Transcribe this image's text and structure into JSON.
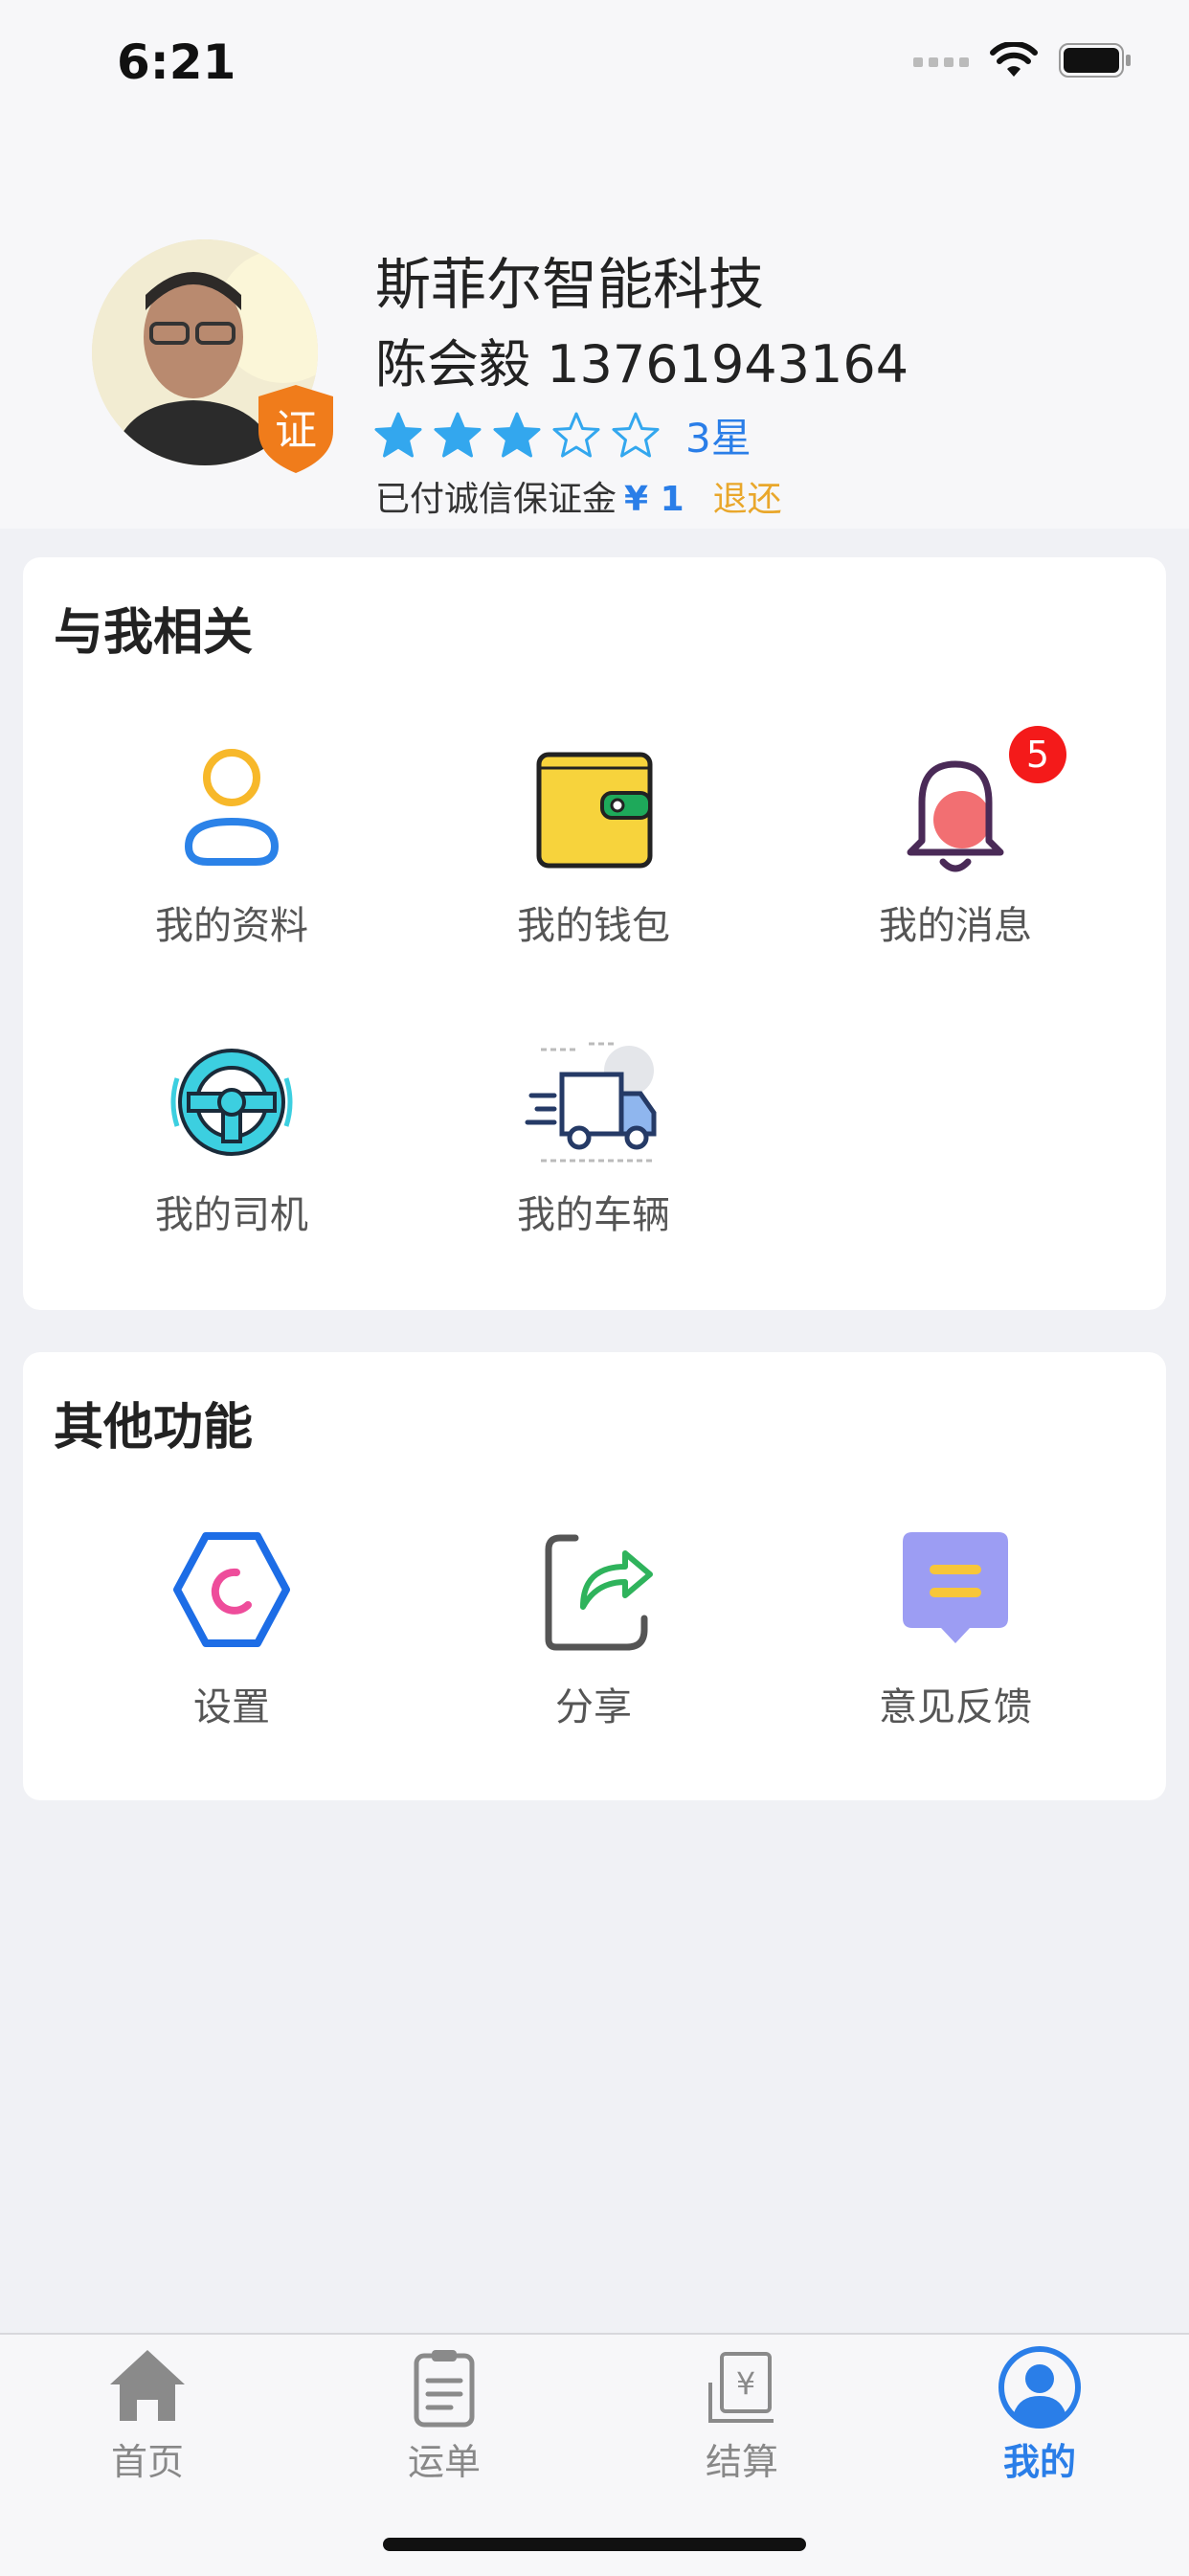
{
  "status_bar": {
    "time": "6:21"
  },
  "profile": {
    "company": "斯菲尔智能科技",
    "person": "陈会毅 13761943164",
    "rating_value": 3,
    "rating_max": 5,
    "rating_label": "3星",
    "deposit_label": "已付诚信保证金",
    "deposit_amount": "¥ 1",
    "refund_label": "退还",
    "cert_badge_text": "证"
  },
  "section_related": {
    "title": "与我相关",
    "items": [
      {
        "label": "我的资料",
        "icon": "profile-icon"
      },
      {
        "label": "我的钱包",
        "icon": "wallet-icon"
      },
      {
        "label": "我的消息",
        "icon": "bell-icon",
        "badge": "5"
      },
      {
        "label": "我的司机",
        "icon": "steering-wheel-icon"
      },
      {
        "label": "我的车辆",
        "icon": "truck-icon"
      }
    ]
  },
  "section_other": {
    "title": "其他功能",
    "items": [
      {
        "label": "设置",
        "icon": "settings-icon"
      },
      {
        "label": "分享",
        "icon": "share-icon"
      },
      {
        "label": "意见反馈",
        "icon": "feedback-icon"
      }
    ]
  },
  "tab_bar": {
    "active": "我的",
    "tabs": [
      {
        "label": "首页",
        "icon": "home-icon"
      },
      {
        "label": "运单",
        "icon": "clipboard-icon"
      },
      {
        "label": "结算",
        "icon": "settlement-icon"
      },
      {
        "label": "我的",
        "icon": "user-circle-icon"
      }
    ]
  },
  "colors": {
    "accent": "#2a7ee8",
    "refund": "#e9a72b",
    "badge": "#f41a1a",
    "background": "#f0f1f5"
  }
}
